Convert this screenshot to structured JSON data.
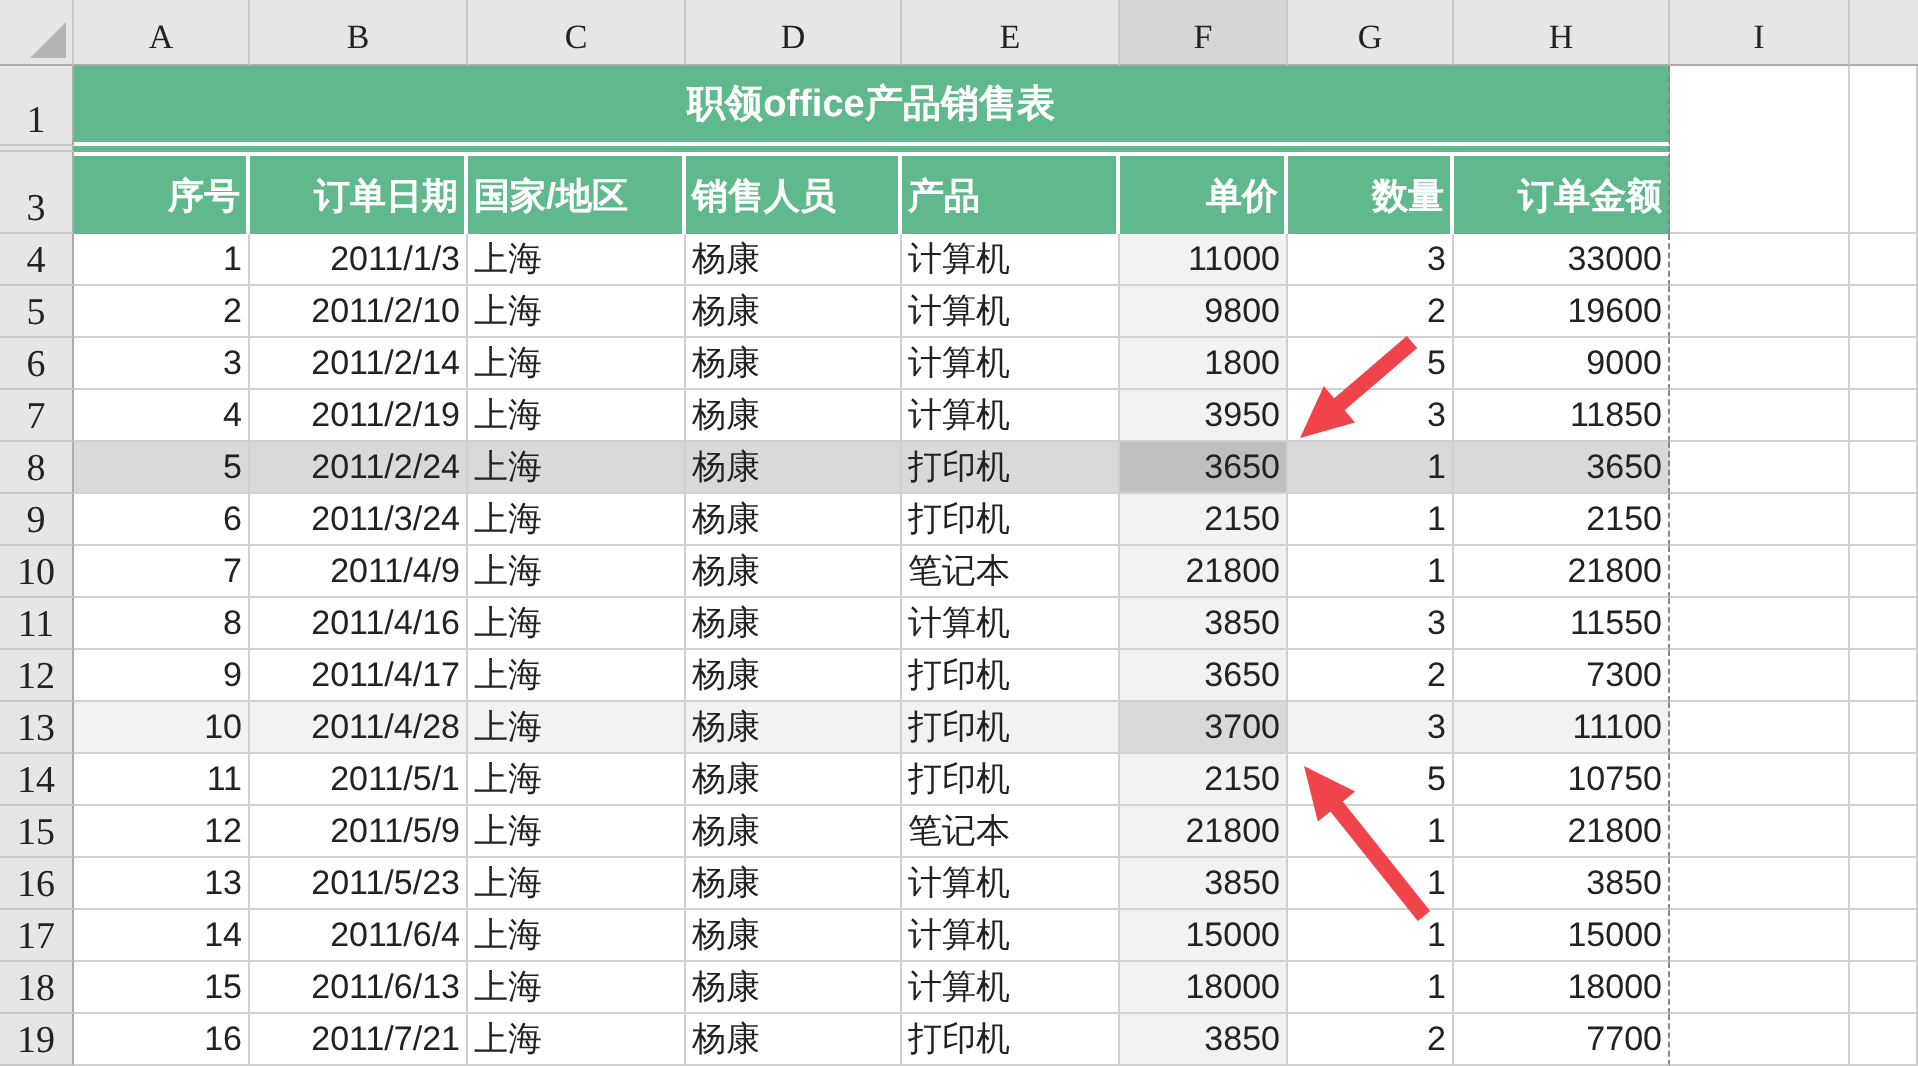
{
  "columns": [
    {
      "label": "A",
      "highlighted": false
    },
    {
      "label": "B",
      "highlighted": false
    },
    {
      "label": "C",
      "highlighted": false
    },
    {
      "label": "D",
      "highlighted": false
    },
    {
      "label": "E",
      "highlighted": false
    },
    {
      "label": "F",
      "highlighted": true
    },
    {
      "label": "G",
      "highlighted": false
    },
    {
      "label": "H",
      "highlighted": false
    },
    {
      "label": "I",
      "highlighted": false
    }
  ],
  "title_row": {
    "number": "1",
    "title": "职领office产品销售表"
  },
  "header_row": {
    "number": "3",
    "cells": [
      "序号",
      "订单日期",
      "国家/地区",
      "销售人员",
      "产品",
      "单价",
      "数量",
      "订单金额"
    ]
  },
  "rows": [
    {
      "number": "4",
      "selected": false,
      "highlighted": false,
      "cells": [
        "1",
        "2011/1/3",
        "上海",
        "杨康",
        "计算机",
        "11000",
        "3",
        "33000"
      ]
    },
    {
      "number": "5",
      "selected": false,
      "highlighted": false,
      "cells": [
        "2",
        "2011/2/10",
        "上海",
        "杨康",
        "计算机",
        "9800",
        "2",
        "19600"
      ]
    },
    {
      "number": "6",
      "selected": false,
      "highlighted": false,
      "cells": [
        "3",
        "2011/2/14",
        "上海",
        "杨康",
        "计算机",
        "1800",
        "5",
        "9000"
      ]
    },
    {
      "number": "7",
      "selected": false,
      "highlighted": false,
      "cells": [
        "4",
        "2011/2/19",
        "上海",
        "杨康",
        "计算机",
        "3950",
        "3",
        "11850"
      ]
    },
    {
      "number": "8",
      "selected": true,
      "highlighted": false,
      "cells": [
        "5",
        "2011/2/24",
        "上海",
        "杨康",
        "打印机",
        "3650",
        "1",
        "3650"
      ]
    },
    {
      "number": "9",
      "selected": false,
      "highlighted": false,
      "cells": [
        "6",
        "2011/3/24",
        "上海",
        "杨康",
        "打印机",
        "2150",
        "1",
        "2150"
      ]
    },
    {
      "number": "10",
      "selected": false,
      "highlighted": false,
      "cells": [
        "7",
        "2011/4/9",
        "上海",
        "杨康",
        "笔记本",
        "21800",
        "1",
        "21800"
      ]
    },
    {
      "number": "11",
      "selected": false,
      "highlighted": false,
      "cells": [
        "8",
        "2011/4/16",
        "上海",
        "杨康",
        "计算机",
        "3850",
        "3",
        "11550"
      ]
    },
    {
      "number": "12",
      "selected": false,
      "highlighted": false,
      "cells": [
        "9",
        "2011/4/17",
        "上海",
        "杨康",
        "打印机",
        "3650",
        "2",
        "7300"
      ]
    },
    {
      "number": "13",
      "selected": false,
      "highlighted": true,
      "cells": [
        "10",
        "2011/4/28",
        "上海",
        "杨康",
        "打印机",
        "3700",
        "3",
        "11100"
      ]
    },
    {
      "number": "14",
      "selected": false,
      "highlighted": false,
      "cells": [
        "11",
        "2011/5/1",
        "上海",
        "杨康",
        "打印机",
        "2150",
        "5",
        "10750"
      ]
    },
    {
      "number": "15",
      "selected": false,
      "highlighted": false,
      "cells": [
        "12",
        "2011/5/9",
        "上海",
        "杨康",
        "笔记本",
        "21800",
        "1",
        "21800"
      ]
    },
    {
      "number": "16",
      "selected": false,
      "highlighted": false,
      "cells": [
        "13",
        "2011/5/23",
        "上海",
        "杨康",
        "计算机",
        "3850",
        "1",
        "3850"
      ]
    },
    {
      "number": "17",
      "selected": false,
      "highlighted": false,
      "cells": [
        "14",
        "2011/6/4",
        "上海",
        "杨康",
        "计算机",
        "15000",
        "1",
        "15000"
      ]
    },
    {
      "number": "18",
      "selected": false,
      "highlighted": false,
      "cells": [
        "15",
        "2011/6/13",
        "上海",
        "杨康",
        "计算机",
        "18000",
        "1",
        "18000"
      ]
    },
    {
      "number": "19",
      "selected": false,
      "highlighted": false,
      "cells": [
        "16",
        "2011/7/21",
        "上海",
        "杨康",
        "打印机",
        "3850",
        "2",
        "7700"
      ]
    }
  ]
}
